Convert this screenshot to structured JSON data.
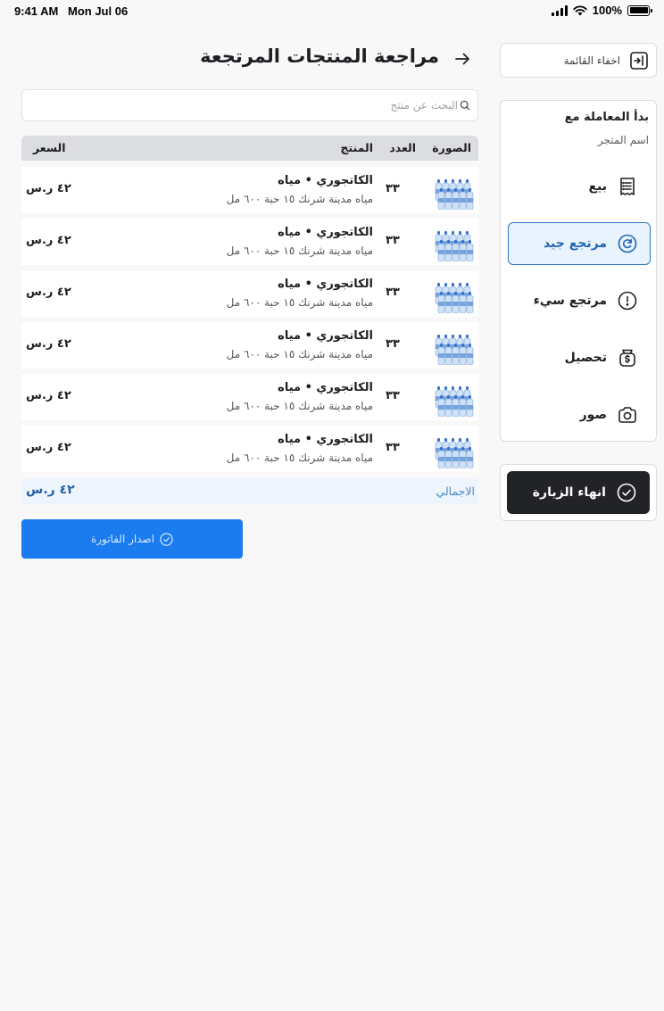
{
  "status_bar": {
    "time": "9:41 AM",
    "date": "Mon Jul 06",
    "battery": "100%",
    "battery_level": 1.0
  },
  "sidebar": {
    "hide_list_label": "اخفاء القائمة",
    "start_with_label": "بدأ المعاملة مع",
    "store_name": "اسم المتجر",
    "items": [
      {
        "label": "بيع",
        "icon": "receipt-icon",
        "active": false
      },
      {
        "label": "مرتجع جيد",
        "icon": "refresh-icon",
        "active": true
      },
      {
        "label": "مرتجع سيء",
        "icon": "alert-circle-icon",
        "active": false
      },
      {
        "label": "تحصيل",
        "icon": "money-bag-icon",
        "active": false
      },
      {
        "label": "صور",
        "icon": "camera-icon",
        "active": false
      }
    ],
    "end_visit_label": "انهاء الزيارة"
  },
  "header": {
    "title": "مراجعة المنتجات المرتجعة"
  },
  "search": {
    "placeholder": "البحث عن منتج"
  },
  "table": {
    "columns": [
      "الصورة",
      "العدد",
      "المنتج",
      "السعر"
    ],
    "rows": [
      {
        "name": "الكاتجوري • مياه",
        "desc": "مياه مدينة شرنك ١٥ حبة ٦٠٠ مل",
        "qty": "٣٣",
        "price": "٤٢ ر.س"
      },
      {
        "name": "الكاتجوري • مياه",
        "desc": "مياه مدينة شرنك ١٥ حبة ٦٠٠ مل",
        "qty": "٣٣",
        "price": "٤٢ ر.س"
      },
      {
        "name": "الكاتجوري • مياه",
        "desc": "مياه مدينة شرنك ١٥ حبة ٦٠٠ مل",
        "qty": "٣٣",
        "price": "٤٢ ر.س"
      },
      {
        "name": "الكاتجوري • مياه",
        "desc": "مياه مدينة شرنك ١٥ حبة ٦٠٠ مل",
        "qty": "٣٣",
        "price": "٤٢ ر.س"
      },
      {
        "name": "الكاتجوري • مياه",
        "desc": "مياه مدينة شرنك ١٥ حبة ٦٠٠ مل",
        "qty": "٣٣",
        "price": "٤٢ ر.س"
      },
      {
        "name": "الكاتجوري • مياه",
        "desc": "مياه مدينة شرنك ١٥ حبة ٦٠٠ مل",
        "qty": "٣٣",
        "price": "٤٢ ر.س"
      }
    ],
    "total_label": "الاجمالي",
    "total_value": "٤٢ ر.س"
  },
  "invoice_button_label": "اصدار الفاتورة",
  "colors": {
    "accent": "#1b7cf0",
    "active_bg": "#e8f3fd",
    "active_border": "#2b78c2",
    "dark_button": "#212326",
    "header_bg": "#dcdde0"
  }
}
